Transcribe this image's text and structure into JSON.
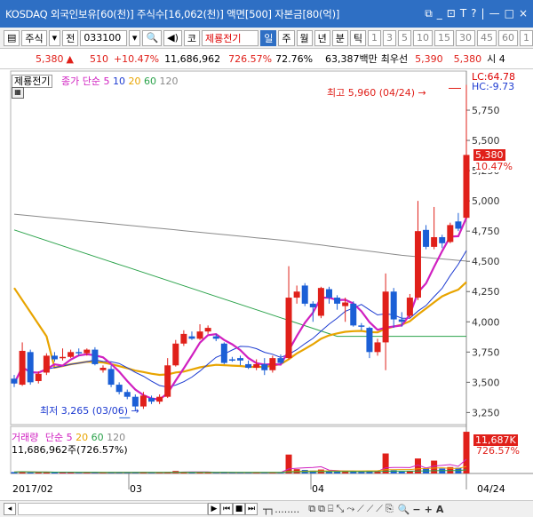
{
  "titlebar": {
    "title": "KOSDAQ 외국인보유[60(천)] 주식수[16,062(천)] 액면[500] 자본금[80(억)]",
    "icons": [
      "restore-icon",
      "minimize-icon",
      "pin-icon",
      "text-icon",
      "help-icon",
      "min-icon",
      "max-icon",
      "close-icon"
    ],
    "glyphs": [
      "⧉",
      "_",
      "⊡",
      "Ŧ",
      "T",
      "?",
      "|",
      "—",
      "□",
      "×"
    ]
  },
  "toolbar": {
    "panel_icon": "▤",
    "market": "주식",
    "dropdown": "▾",
    "jeon": "전",
    "code": "033100",
    "search": "🔍",
    "sound": "◀)",
    "ko": "코",
    "stock_name": "제룡전기",
    "periods": [
      "일",
      "주",
      "월",
      "년",
      "분",
      "틱"
    ],
    "selected_period": "일",
    "numbers": [
      "1",
      "3",
      "5",
      "10",
      "15",
      "30",
      "45",
      "60",
      "1"
    ]
  },
  "quote": {
    "price": "5,380",
    "arrow": "▲",
    "change": "510",
    "pct": "+10.47%",
    "volume": "11,686,962",
    "vol_ratio": "726.57%",
    "turnover": "72.76%",
    "amount": "63,387백만",
    "label": "최우선",
    "ask": "5,390",
    "bid": "5,380",
    "tail": "시 4"
  },
  "price_chart": {
    "legend": {
      "name": "제룡전기",
      "ma": "종가 단순",
      "p5": "5",
      "p10": "10",
      "p20": "20",
      "p60": "60",
      "p120": "120"
    },
    "lc": "LC:64.78",
    "hc": "HC:-9.73",
    "high_note": "최고 5,960 (04/24) →",
    "low_note": "최저 3,265 (03/06) →",
    "last_price": "5,380",
    "last_pct": "10.47%",
    "yticks": [
      "5,750",
      "5,500",
      "5,250",
      "5,000",
      "4,750",
      "4,500",
      "4,250",
      "4,000",
      "3,750",
      "3,500",
      "3,250"
    ]
  },
  "volume_chart": {
    "legend_name": "거래량",
    "legend_ma": "단순",
    "p5": "5",
    "p20": "20",
    "p60": "60",
    "p120": "120",
    "value": "11,686,962주(726.57%)",
    "last_vol": "11,687K",
    "last_pct": "726.57%"
  },
  "xaxis": {
    "labels": [
      "2017/02",
      "03",
      "04"
    ],
    "right": "04/24"
  },
  "bottom_controls": [
    "▶",
    "⏮",
    "■",
    "⏭"
  ],
  "colors": {
    "up": "#e0201a",
    "down": "#1b5fd6",
    "ma5": "#d020c0",
    "ma10": "#1d3bd1",
    "ma20": "#e8a400",
    "ma60": "#2aa24a",
    "ma120": "#8a8a8a"
  },
  "chart_data": {
    "type": "candlestick",
    "title": "제룡전기",
    "x": [
      "2017/02",
      "03",
      "04",
      "04/24"
    ],
    "candles": [
      {
        "o": 3530,
        "c": 3490,
        "h": 3560,
        "l": 3460
      },
      {
        "o": 3480,
        "c": 3760,
        "h": 3830,
        "l": 3470
      },
      {
        "o": 3750,
        "c": 3500,
        "h": 3770,
        "l": 3480
      },
      {
        "o": 3510,
        "c": 3570,
        "h": 3590,
        "l": 3490
      },
      {
        "o": 3580,
        "c": 3720,
        "h": 3740,
        "l": 3560
      },
      {
        "o": 3720,
        "c": 3690,
        "h": 3750,
        "l": 3670
      },
      {
        "o": 3700,
        "c": 3710,
        "h": 3780,
        "l": 3680
      },
      {
        "o": 3710,
        "c": 3750,
        "h": 3770,
        "l": 3700
      },
      {
        "o": 3750,
        "c": 3740,
        "h": 3780,
        "l": 3720
      },
      {
        "o": 3740,
        "c": 3770,
        "h": 3780,
        "l": 3720
      },
      {
        "o": 3770,
        "c": 3650,
        "h": 3790,
        "l": 3640
      },
      {
        "o": 3600,
        "c": 3620,
        "h": 3640,
        "l": 3580
      },
      {
        "o": 3610,
        "c": 3480,
        "h": 3640,
        "l": 3460
      },
      {
        "o": 3480,
        "c": 3420,
        "h": 3500,
        "l": 3400
      },
      {
        "o": 3420,
        "c": 3380,
        "h": 3440,
        "l": 3360
      },
      {
        "o": 3380,
        "c": 3300,
        "h": 3400,
        "l": 3265
      },
      {
        "o": 3300,
        "c": 3390,
        "h": 3420,
        "l": 3280
      },
      {
        "o": 3370,
        "c": 3340,
        "h": 3390,
        "l": 3320
      },
      {
        "o": 3340,
        "c": 3380,
        "h": 3400,
        "l": 3320
      },
      {
        "o": 3380,
        "c": 3640,
        "h": 3700,
        "l": 3370
      },
      {
        "o": 3640,
        "c": 3820,
        "h": 3850,
        "l": 3630
      },
      {
        "o": 3820,
        "c": 3900,
        "h": 3930,
        "l": 3800
      },
      {
        "o": 3880,
        "c": 3860,
        "h": 3920,
        "l": 3850
      },
      {
        "o": 3860,
        "c": 3920,
        "h": 3980,
        "l": 3850
      },
      {
        "o": 3920,
        "c": 3950,
        "h": 3970,
        "l": 3900
      },
      {
        "o": 3880,
        "c": 3860,
        "h": 3900,
        "l": 3840
      },
      {
        "o": 3820,
        "c": 3660,
        "h": 3830,
        "l": 3650
      },
      {
        "o": 3690,
        "c": 3680,
        "h": 3710,
        "l": 3670
      },
      {
        "o": 3700,
        "c": 3680,
        "h": 3720,
        "l": 3640
      },
      {
        "o": 3650,
        "c": 3620,
        "h": 3680,
        "l": 3610
      },
      {
        "o": 3620,
        "c": 3650,
        "h": 3690,
        "l": 3600
      },
      {
        "o": 3650,
        "c": 3600,
        "h": 3700,
        "l": 3560
      },
      {
        "o": 3600,
        "c": 3700,
        "h": 3720,
        "l": 3580
      },
      {
        "o": 3700,
        "c": 3660,
        "h": 3730,
        "l": 3650
      },
      {
        "o": 3700,
        "c": 4200,
        "h": 4460,
        "l": 3690
      },
      {
        "o": 4200,
        "c": 4250,
        "h": 4300,
        "l": 4150
      },
      {
        "o": 4300,
        "c": 4150,
        "h": 4320,
        "l": 4130
      },
      {
        "o": 4150,
        "c": 4120,
        "h": 4170,
        "l": 4000
      },
      {
        "o": 4050,
        "c": 4280,
        "h": 4290,
        "l": 4030
      },
      {
        "o": 4270,
        "c": 4200,
        "h": 4290,
        "l": 4150
      },
      {
        "o": 4200,
        "c": 4150,
        "h": 4220,
        "l": 4100
      },
      {
        "o": 4130,
        "c": 4160,
        "h": 4200,
        "l": 4000
      },
      {
        "o": 4150,
        "c": 3970,
        "h": 4170,
        "l": 3960
      },
      {
        "o": 3970,
        "c": 3960,
        "h": 3990,
        "l": 3930
      },
      {
        "o": 3950,
        "c": 3750,
        "h": 3960,
        "l": 3700
      },
      {
        "o": 3750,
        "c": 3830,
        "h": 3860,
        "l": 3720
      },
      {
        "o": 3830,
        "c": 4250,
        "h": 4400,
        "l": 3600
      },
      {
        "o": 4250,
        "c": 4020,
        "h": 4280,
        "l": 3950
      },
      {
        "o": 4020,
        "c": 4000,
        "h": 4080,
        "l": 3960
      },
      {
        "o": 4050,
        "c": 4200,
        "h": 4230,
        "l": 4030
      },
      {
        "o": 4200,
        "c": 4750,
        "h": 5000,
        "l": 4180
      },
      {
        "o": 4760,
        "c": 4620,
        "h": 4800,
        "l": 4600
      },
      {
        "o": 4620,
        "c": 4700,
        "h": 4950,
        "l": 4600
      },
      {
        "o": 4700,
        "c": 4650,
        "h": 4720,
        "l": 4610
      },
      {
        "o": 4660,
        "c": 4800,
        "h": 4820,
        "l": 4650
      },
      {
        "o": 4830,
        "c": 4770,
        "h": 4900,
        "l": 4750
      },
      {
        "o": 4860,
        "c": 5380,
        "h": 5960,
        "l": 4850
      }
    ],
    "volume": [
      0.4,
      0.6,
      0.3,
      0.3,
      0.4,
      0.3,
      0.3,
      0.3,
      0.2,
      0.3,
      0.3,
      0.2,
      0.4,
      0.3,
      0.3,
      0.4,
      0.3,
      0.2,
      0.2,
      0.4,
      0.7,
      0.5,
      0.3,
      0.3,
      0.3,
      0.2,
      0.4,
      0.2,
      0.2,
      0.2,
      0.3,
      0.3,
      0.3,
      0.2,
      5.3,
      1.2,
      1.0,
      0.8,
      1.1,
      0.6,
      0.5,
      0.5,
      0.6,
      0.4,
      0.8,
      0.6,
      5.6,
      0.9,
      0.5,
      0.6,
      4.2,
      1.5,
      3.6,
      1.4,
      1.8,
      1.6,
      11.687
    ],
    "yrange": [
      3150,
      6000
    ],
    "vol_range": [
      0,
      12.2
    ]
  }
}
